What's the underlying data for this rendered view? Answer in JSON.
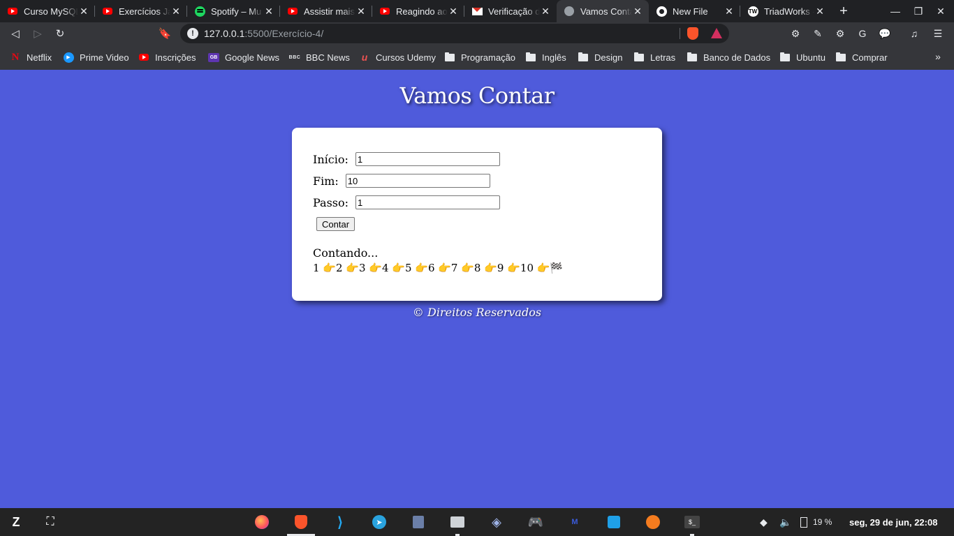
{
  "browser": {
    "tabs": [
      {
        "title": "Curso MySQL",
        "icon": "youtube-icon"
      },
      {
        "title": "Exercícios Ja",
        "icon": "youtube-icon"
      },
      {
        "title": "Spotify – Mu",
        "icon": "spotify-icon"
      },
      {
        "title": "Assistir mais",
        "icon": "youtube-icon"
      },
      {
        "title": "Reagindo aos",
        "icon": "youtube-icon"
      },
      {
        "title": "Verificação d",
        "icon": "gmail-icon"
      },
      {
        "title": "Vamos Conta",
        "icon": "globe-icon",
        "active": true
      },
      {
        "title": "New File",
        "icon": "github-icon"
      },
      {
        "title": "TriadWorks -",
        "icon": "triadworks-icon"
      }
    ],
    "url_host": "127.0.0.1",
    "url_path": ":5500/Exercício-4/",
    "bookmarks": [
      {
        "label": "Netflix",
        "icon": "netflix-icon"
      },
      {
        "label": "Prime Video",
        "icon": "prime-video-icon"
      },
      {
        "label": "Inscrições",
        "icon": "youtube-icon"
      },
      {
        "label": "Google News",
        "icon": "google-news-icon"
      },
      {
        "label": "BBC News",
        "icon": "bbc-icon"
      },
      {
        "label": "Cursos Udemy",
        "icon": "udemy-icon"
      },
      {
        "label": "Programação",
        "icon": "folder-icon"
      },
      {
        "label": "Inglês",
        "icon": "folder-icon"
      },
      {
        "label": "Design",
        "icon": "folder-icon"
      },
      {
        "label": "Letras",
        "icon": "folder-icon"
      },
      {
        "label": "Banco de Dados",
        "icon": "folder-icon"
      },
      {
        "label": "Ubuntu",
        "icon": "folder-icon"
      },
      {
        "label": "Comprar",
        "icon": "folder-icon"
      }
    ]
  },
  "page": {
    "heading": "Vamos Contar",
    "form": {
      "inicio_label": "Início:",
      "inicio_value": "1",
      "fim_label": "Fim:",
      "fim_value": "10",
      "passo_label": "Passo:",
      "passo_value": "1",
      "button_label": "Contar"
    },
    "result_label": "Contando...",
    "result_sequence": "1 👉2 👉3 👉4 👉5 👉6 👉7 👉8 👉9 👉10 👉🏁",
    "footer": "© Direitos Reservados"
  },
  "taskbar": {
    "battery": "19 %",
    "clock": "seg, 29 de jun, 22:08"
  },
  "colors": {
    "page_background": "#4f5bdb",
    "card_background": "#ffffff"
  }
}
